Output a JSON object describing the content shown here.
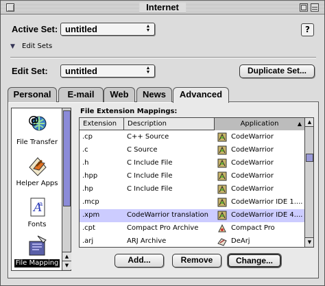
{
  "window": {
    "title": "Internet"
  },
  "active_set": {
    "label": "Active Set:",
    "value": "untitled"
  },
  "edit_sets_toggle": {
    "label": "Edit Sets"
  },
  "help_button": {
    "label": "?"
  },
  "edit_set": {
    "label": "Edit Set:",
    "value": "untitled"
  },
  "duplicate_button": {
    "label": "Duplicate Set..."
  },
  "tabs": [
    {
      "label": "Personal",
      "active": false
    },
    {
      "label": "E-mail",
      "active": false
    },
    {
      "label": "Web",
      "active": false
    },
    {
      "label": "News",
      "active": false
    },
    {
      "label": "Advanced",
      "active": true
    }
  ],
  "sidebar": {
    "items": [
      {
        "label": "File Transfer",
        "icon": "file-transfer-icon",
        "selected": false
      },
      {
        "label": "Helper Apps",
        "icon": "helper-apps-icon",
        "selected": false
      },
      {
        "label": "Fonts",
        "icon": "fonts-icon",
        "selected": false
      },
      {
        "label": "File Mapping",
        "icon": "file-mapping-icon",
        "selected": true
      }
    ]
  },
  "mappings": {
    "title": "File Extension Mappings:",
    "columns": [
      "Extension",
      "Description",
      "Application"
    ],
    "sorted_column": "Application",
    "rows": [
      {
        "ext": ".cp",
        "desc": "C++ Source",
        "app": "CodeWarrior",
        "app_icon": "codewarrior-icon",
        "selected": false
      },
      {
        "ext": ".c",
        "desc": "C Source",
        "app": "CodeWarrior",
        "app_icon": "codewarrior-icon",
        "selected": false
      },
      {
        "ext": ".h",
        "desc": "C Include File",
        "app": "CodeWarrior",
        "app_icon": "codewarrior-icon",
        "selected": false
      },
      {
        "ext": ".hpp",
        "desc": "C Include File",
        "app": "CodeWarrior",
        "app_icon": "codewarrior-icon",
        "selected": false
      },
      {
        "ext": ".hp",
        "desc": "C Include File",
        "app": "CodeWarrior",
        "app_icon": "codewarrior-icon",
        "selected": false
      },
      {
        "ext": ".mcp",
        "desc": "",
        "app": "CodeWarrior IDE 1....",
        "app_icon": "codewarrior-icon",
        "selected": false
      },
      {
        "ext": ".xpm",
        "desc": "CodeWarrior translation",
        "app": "CodeWarrior IDE 4....",
        "app_icon": "codewarrior-icon",
        "selected": true
      },
      {
        "ext": ".cpt",
        "desc": "Compact Pro Archive",
        "app": "Compact Pro",
        "app_icon": "compact-pro-icon",
        "selected": false
      },
      {
        "ext": ".arj",
        "desc": "ARJ Archive",
        "app": "DeArj",
        "app_icon": "dearj-icon",
        "selected": false
      }
    ]
  },
  "buttons": {
    "add": "Add...",
    "remove": "Remove",
    "change": "Change..."
  },
  "colors": {
    "selection": "#ccccff",
    "scroll_thumb": "#8b8bd8"
  }
}
